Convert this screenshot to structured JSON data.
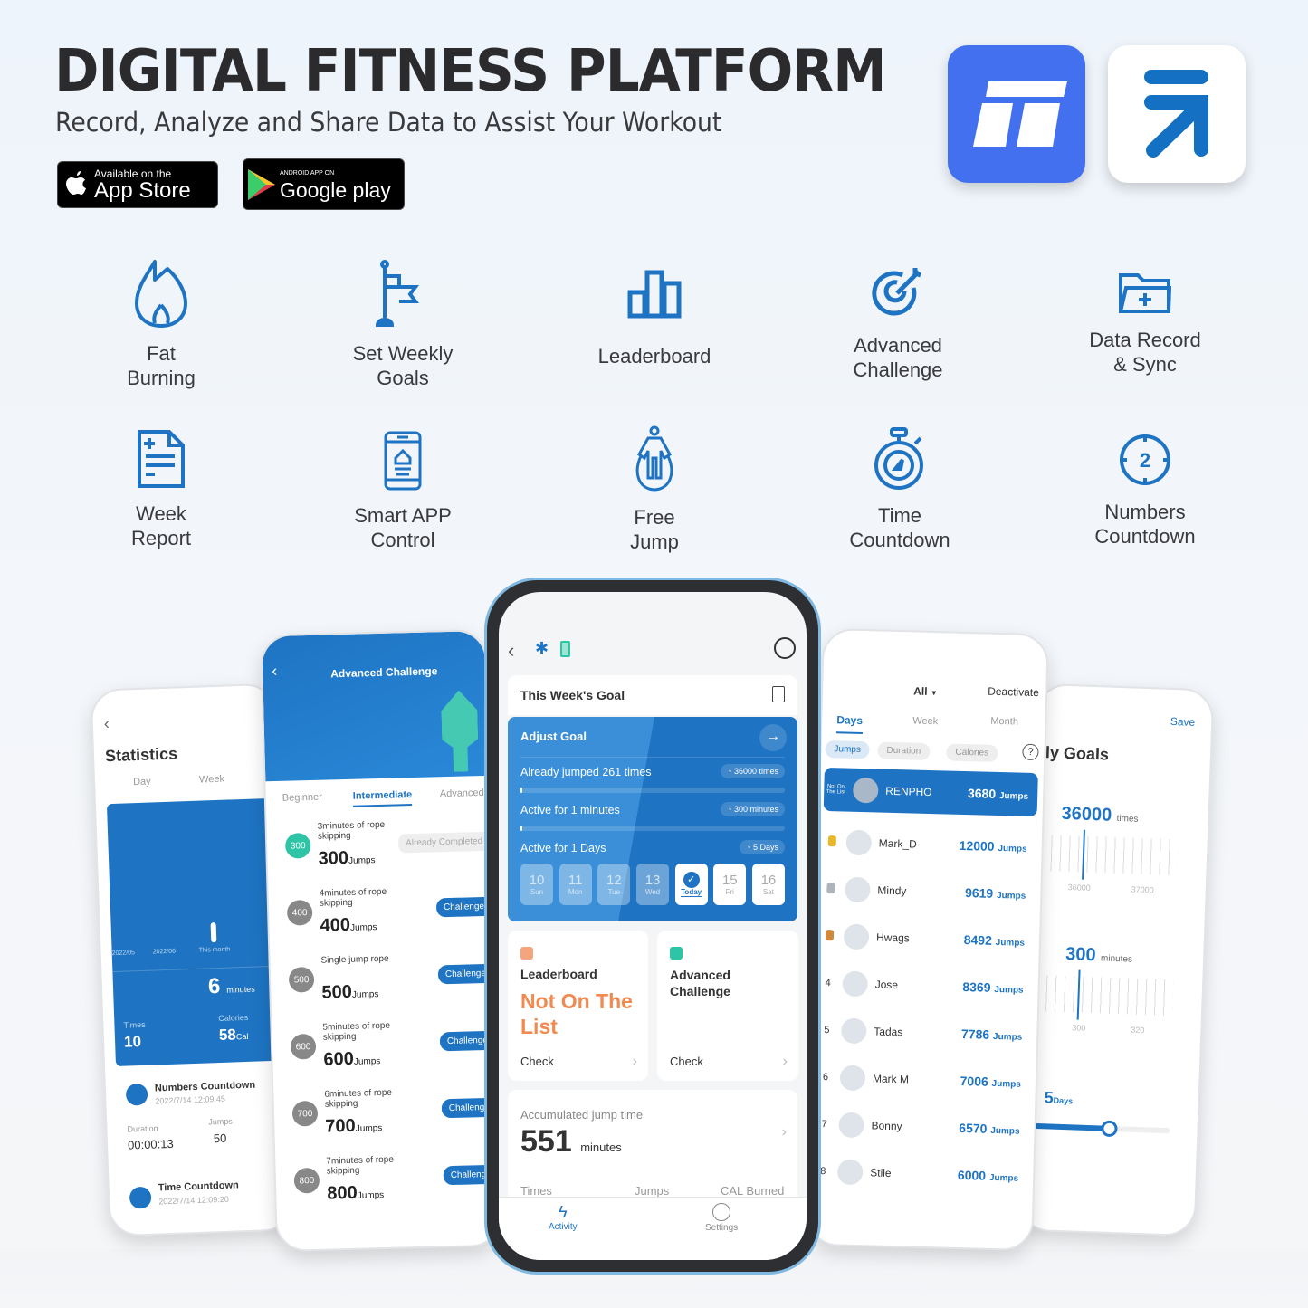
{
  "header": {
    "title": "DIGITAL FITNESS PLATFORM",
    "subtitle": "Record, Analyze and Share Data to Assist Your Workout",
    "app_store": {
      "small": "Available on the",
      "big": "App Store"
    },
    "google_play": {
      "small": "ANDROID APP ON",
      "big": "Google play"
    }
  },
  "colors": {
    "accent": "#1e74c3",
    "brand_blue": "#4270ef",
    "orange": "#f08a50",
    "teal": "#2ec4a6"
  },
  "features": [
    {
      "icon": "flame-icon",
      "label_1": "Fat",
      "label_2": "Burning"
    },
    {
      "icon": "flag-icon",
      "label_1": "Set Weekly",
      "label_2": "Goals"
    },
    {
      "icon": "bar-chart-icon",
      "label_1": "Leaderboard",
      "label_2": ""
    },
    {
      "icon": "target-icon",
      "label_1": "Advanced",
      "label_2": "Challenge"
    },
    {
      "icon": "folder-plus-icon",
      "label_1": "Data Record",
      "label_2": "& Sync"
    },
    {
      "icon": "document-icon",
      "label_1": "Week",
      "label_2": "Report"
    },
    {
      "icon": "smartphone-icon",
      "label_1": "Smart APP",
      "label_2": "Control"
    },
    {
      "icon": "jump-rope-icon",
      "label_1": "Free",
      "label_2": "Jump"
    },
    {
      "icon": "stopwatch-icon",
      "label_1": "Time",
      "label_2": "Countdown"
    },
    {
      "icon": "countdown-icon",
      "label_1": "Numbers",
      "label_2": "Countdown"
    }
  ],
  "stats_screen": {
    "title": "Statistics",
    "tabs": [
      "Day",
      "Week"
    ],
    "axis": [
      "2022/05",
      "2022/06",
      "This month"
    ],
    "minutes": "6",
    "minutes_unit": "minutes",
    "times_label": "Times",
    "times_value": "10",
    "calories_label": "Calories",
    "calories_value": "58",
    "calories_unit": "Cal",
    "records": [
      {
        "title": "Numbers Countdown",
        "date": "2022/7/14  12:09:45",
        "duration_label": "Duration",
        "duration": "00:00:13",
        "jumps_label": "Jumps",
        "jumps": "50"
      },
      {
        "title": "Time Countdown",
        "date": "2022/7/14  12:09:20"
      }
    ]
  },
  "challenge_screen": {
    "title": "Advanced Challenge",
    "tabs": [
      "Beginner",
      "Intermediate",
      "Advanced"
    ],
    "items": [
      {
        "badge": "300",
        "desc": "3minutes of rope skipping",
        "value": "300",
        "unit": "Jumps",
        "action": "Already Completed"
      },
      {
        "badge": "400",
        "desc": "4minutes of rope skipping",
        "value": "400",
        "unit": "Jumps",
        "action": "Challenge"
      },
      {
        "badge": "500",
        "desc": "Single jump rope",
        "value": "500",
        "unit": "Jumps",
        "action": "Challenge"
      },
      {
        "badge": "600",
        "desc": "5minutes of rope skipping",
        "value": "600",
        "unit": "Jumps",
        "action": "Challenge"
      },
      {
        "badge": "700",
        "desc": "6minutes of rope skipping",
        "value": "700",
        "unit": "Jumps",
        "action": "Challenge"
      },
      {
        "badge": "800",
        "desc": "7minutes of rope skipping",
        "value": "800",
        "unit": "Jumps",
        "action": "Challenge"
      }
    ]
  },
  "main_screen": {
    "goal_title": "This Week's Goal",
    "adjust_goal": "Adjust Goal",
    "progress": [
      {
        "label": "Already jumped 261 times",
        "target": "36000 times",
        "fraction": 0.007
      },
      {
        "label": "Active for 1 minutes",
        "target": "300 minutes",
        "fraction": 0.003
      },
      {
        "label": "Active for 1 Days",
        "target": "5 Days"
      }
    ],
    "days": [
      {
        "n": "10",
        "d": "Sun"
      },
      {
        "n": "11",
        "d": "Mon"
      },
      {
        "n": "12",
        "d": "Tue"
      },
      {
        "n": "13",
        "d": "Wed"
      },
      {
        "n": "",
        "d": "Today"
      },
      {
        "n": "15",
        "d": "Fri"
      },
      {
        "n": "16",
        "d": "Sat"
      }
    ],
    "leaderboard_card": {
      "title": "Leaderboard",
      "status": "Not On The List",
      "check": "Check"
    },
    "challenge_card": {
      "title": "Advanced Challenge",
      "check": "Check"
    },
    "accumulated_label": "Accumulated jump time",
    "accumulated_value": "551",
    "accumulated_unit": "minutes",
    "summary_headers": [
      "Times",
      "Jumps",
      "CAL Burned"
    ],
    "nav": {
      "activity": "Activity",
      "settings": "Settings"
    }
  },
  "leader_screen": {
    "filter": "All",
    "deactivate": "Deactivate",
    "tabs": [
      "Days",
      "Week",
      "Month"
    ],
    "chips": [
      "Jumps",
      "Duration",
      "Calories"
    ],
    "me": {
      "rank": "Not On The List",
      "name": "RENPHO",
      "score": "3680",
      "unit": "Jumps"
    },
    "rows": [
      {
        "rank": "1",
        "name": "Mark_D",
        "score": "12000",
        "unit": "Jumps"
      },
      {
        "rank": "2",
        "name": "Mindy",
        "score": "9619",
        "unit": "Jumps"
      },
      {
        "rank": "3",
        "name": "Hwags",
        "score": "8492",
        "unit": "Jumps"
      },
      {
        "rank": "4",
        "name": "Jose",
        "score": "8369",
        "unit": "Jumps"
      },
      {
        "rank": "5",
        "name": "Tadas",
        "score": "7786",
        "unit": "Jumps"
      },
      {
        "rank": "6",
        "name": "Mark M",
        "score": "7006",
        "unit": "Jumps"
      },
      {
        "rank": "7",
        "name": "Bonny",
        "score": "6570",
        "unit": "Jumps"
      },
      {
        "rank": "8",
        "name": "Stile",
        "score": "6000",
        "unit": "Jumps"
      }
    ]
  },
  "goals_screen": {
    "save": "Save",
    "title": "ly Goals",
    "times_value": "36000",
    "times_unit": "times",
    "times_ticks": [
      "36000",
      "37000"
    ],
    "minutes_value": "300",
    "minutes_unit": "minutes",
    "minutes_ticks": [
      "300",
      "320"
    ],
    "days_value": "5",
    "days_unit": "Days",
    "days_fraction": 0.55
  }
}
